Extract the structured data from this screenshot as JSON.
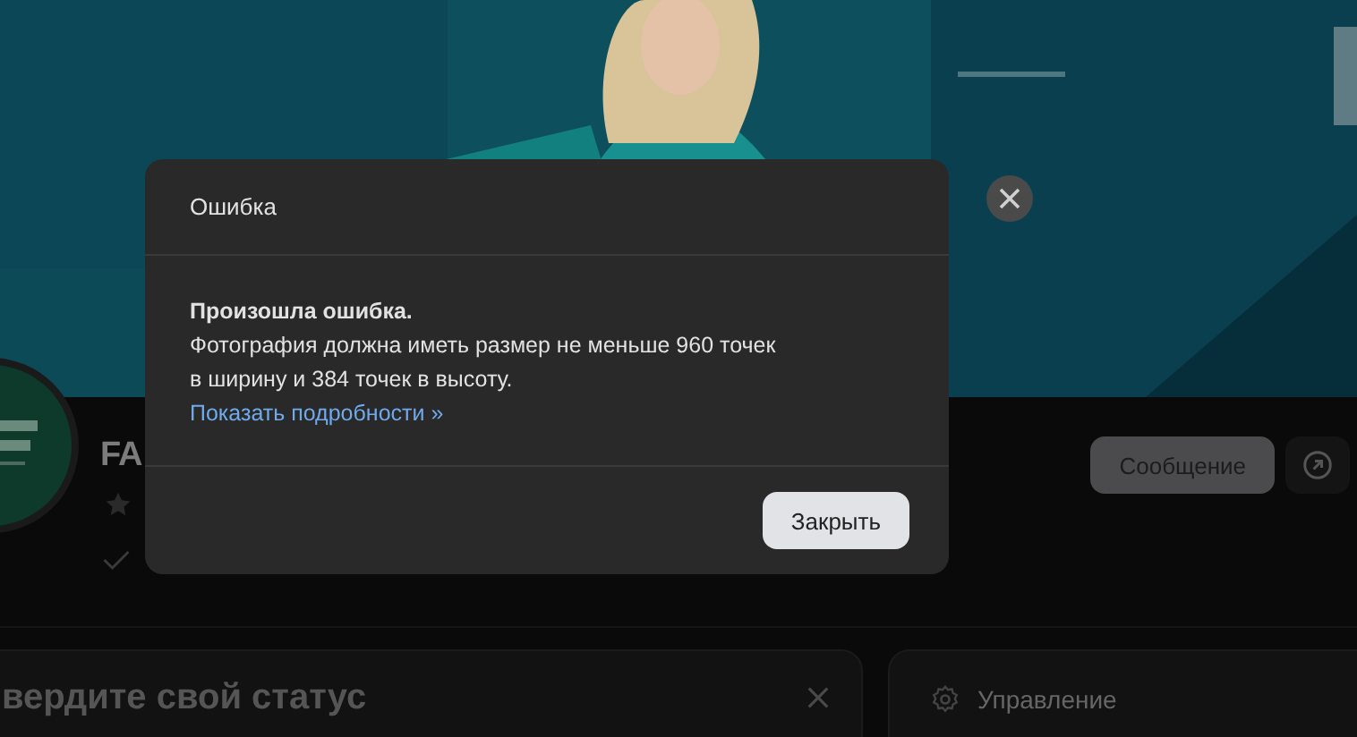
{
  "community": {
    "name": "FA"
  },
  "actions": {
    "message_button": "Сообщение"
  },
  "status_card": {
    "title": "вердите свой статус"
  },
  "manage_card": {
    "label": "Управление"
  },
  "dialog": {
    "title": "Ошибка",
    "heading": "Произошла ошибка.",
    "message_lines": [
      "Фотография должна иметь размер не меньше 960 точек",
      "в ширину и 384 точек в высоту."
    ],
    "details_link": "Показать подробности »",
    "close_button": "Закрыть"
  }
}
